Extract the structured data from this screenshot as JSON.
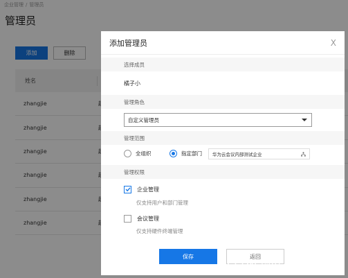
{
  "breadcrumb": [
    "企业管理",
    "管理员"
  ],
  "breadcrumb_sep": "/",
  "page_title": "管理员",
  "toolbar": {
    "add_label": "添加",
    "delete_label": "删除"
  },
  "table": {
    "header_name": "姓名",
    "rows": [
      {
        "name": "zhangjie",
        "role": "超"
      },
      {
        "name": "zhangjie",
        "role": "超"
      },
      {
        "name": "zhangjie",
        "role": "超"
      },
      {
        "name": "zhangjie",
        "role": "超"
      },
      {
        "name": "zhangjie",
        "role": "超"
      },
      {
        "name": "zhangjie",
        "role": "超"
      }
    ]
  },
  "modal": {
    "title": "添加管理员",
    "close_symbol": "X",
    "member_section": "选择成员",
    "member_name": "橘子小",
    "role_section": "管理角色",
    "role_value": "自定义管理员",
    "scope_section": "管理范围",
    "scope_all_label": "全组织",
    "scope_dept_label": "指定部门",
    "scope_dept_value": "华为云会议内部测试企业",
    "perm_section": "管理权限",
    "perm_enterprise_label": "企业管理",
    "perm_enterprise_desc": "仅支持用户和部门管理",
    "perm_meeting_label": "会议管理",
    "perm_meeting_desc": "仅支持硬件终端管理",
    "save_label": "保存",
    "back_label": "返回"
  },
  "watermark": "CSDN @i生活i科技",
  "colors": {
    "accent": "#1677e6",
    "overlay": "rgba(0,0,0,0.45)"
  }
}
